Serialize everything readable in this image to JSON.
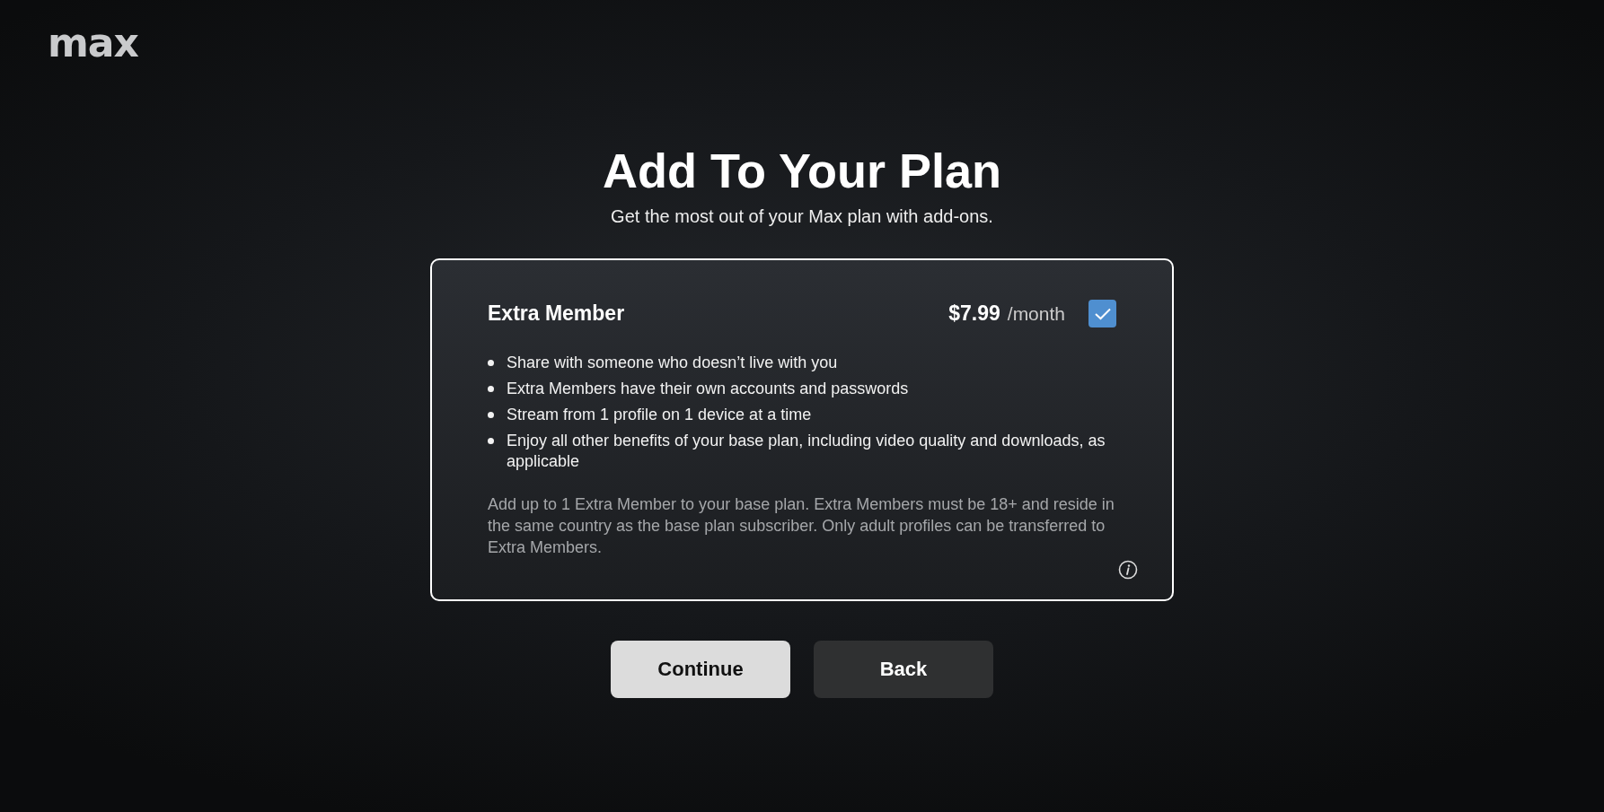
{
  "logo": "max",
  "heading": {
    "title": "Add To Your Plan",
    "subtitle": "Get the most out of your Max plan with add-ons."
  },
  "addon": {
    "name": "Extra Member",
    "price": "$7.99",
    "period": "/month",
    "checked": true,
    "benefits": [
      "Share with someone who doesn’t live with you",
      "Extra Members have their own accounts and passwords",
      "Stream from 1 profile on 1 device at a time",
      "Enjoy all other benefits of your base plan, including video quality and downloads, as applicable"
    ],
    "note": "Add up to 1 Extra Member to your base plan. Extra Members must be 18+ and reside in the same country as the base plan subscriber. Only adult profiles can be transferred to Extra Members."
  },
  "buttons": [
    {
      "label": "Continue",
      "kind": "primary"
    },
    {
      "label": "Back",
      "kind": "secondary"
    }
  ]
}
